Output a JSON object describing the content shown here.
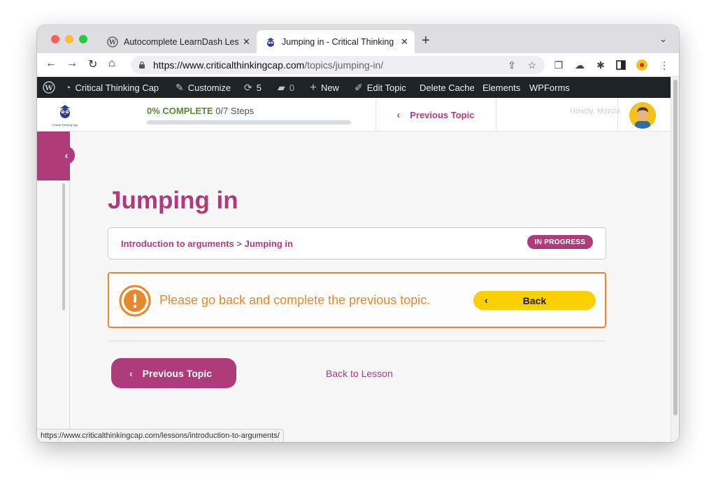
{
  "browser": {
    "tabs": [
      {
        "title": "Autocomplete LearnDash Lesso",
        "active": false
      },
      {
        "title": "Jumping in - Critical Thinking C",
        "active": true
      }
    ],
    "url_host": "https://www.criticalthinkingcap.com",
    "url_path": "/topics/jumping-in/"
  },
  "adminbar": {
    "site_name": "Critical Thinking Cap",
    "customize": "Customize",
    "updates_count": "5",
    "comments_count": "0",
    "new": "New",
    "edit_topic": "Edit Topic",
    "delete_cache": "Delete Cache",
    "elements": "Elements",
    "wpforms": "WPForms"
  },
  "header": {
    "logo_text": "Critical Thinking Cap",
    "progress_percent_label": "0% COMPLETE",
    "progress_steps": "0/7 Steps",
    "progress_fraction": 0,
    "prev_topic": "Previous Topic",
    "howdy": "Howdy, Marcia"
  },
  "main": {
    "title": "Jumping in",
    "breadcrumb": {
      "parent": "Introduction to arguments",
      "separator": ">",
      "current": "Jumping in"
    },
    "status_badge": "IN PROGRESS",
    "alert": {
      "message": "Please go back and complete the previous topic.",
      "back_label": "Back"
    },
    "prev_topic_button": "Previous Topic",
    "back_to_lesson": "Back to Lesson"
  },
  "status_bar_url": "https://www.criticalthinkingcap.com/lessons/introduction-to-arguments/",
  "colors": {
    "brand": "#b03b7a",
    "warning": "#e8882d",
    "back_button": "#fbd000",
    "progress": "#5a8a3a",
    "adminbar": "#1d2327"
  }
}
